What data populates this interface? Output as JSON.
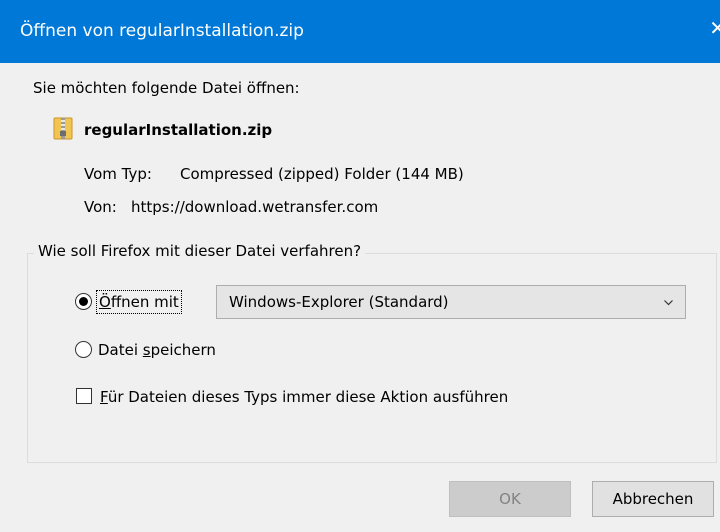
{
  "window": {
    "title": "Öffnen von regularInstallation.zip",
    "close_glyph": "✕",
    "titlebar_color": "#0078d7"
  },
  "prompt": "Sie möchten folgende Datei öffnen:",
  "file": {
    "icon": "zip-folder-icon",
    "name": "regularInstallation.zip",
    "type_label": "Vom Typ:",
    "type_value": "Compressed (zipped) Folder (144 MB)",
    "from_label": "Von:",
    "from_value": "https://download.wetransfer.com"
  },
  "action_group": {
    "legend": "Wie soll Firefox mit dieser Datei verfahren?",
    "open_with": {
      "label_accesskey": "Ö",
      "label_rest": "ffnen mit",
      "selected": true,
      "app_selected": "Windows-Explorer (Standard)"
    },
    "save": {
      "label_before": "Datei ",
      "label_accesskey": "s",
      "label_rest": "peichern",
      "selected": false
    },
    "always": {
      "label_accesskey": "F",
      "label_rest": "ür Dateien dieses Typs immer diese Aktion ausführen",
      "checked": false
    }
  },
  "buttons": {
    "ok": "OK",
    "ok_enabled": false,
    "cancel": "Abbrechen"
  }
}
